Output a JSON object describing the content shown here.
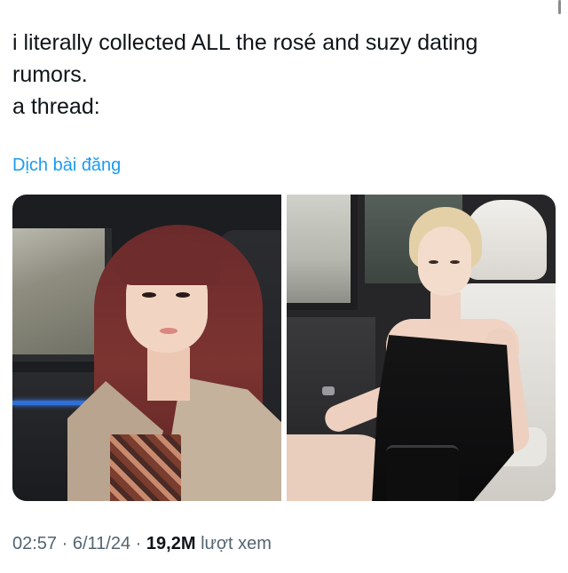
{
  "tweet": {
    "lines": [
      "i literally collected ALL the rosé and suzy dating",
      "rumors.",
      "a thread:"
    ],
    "translate_label": "Dịch bài đăng"
  },
  "media": {
    "photos": [
      "photo-1",
      "photo-2"
    ]
  },
  "meta": {
    "time": "02:57",
    "separator": "·",
    "date": "6/11/24",
    "views_count": "19,2M",
    "views_label": "lượt xem"
  },
  "colors": {
    "accent": "#1d9bf0",
    "text": "#0f1419",
    "muted": "#536471"
  }
}
